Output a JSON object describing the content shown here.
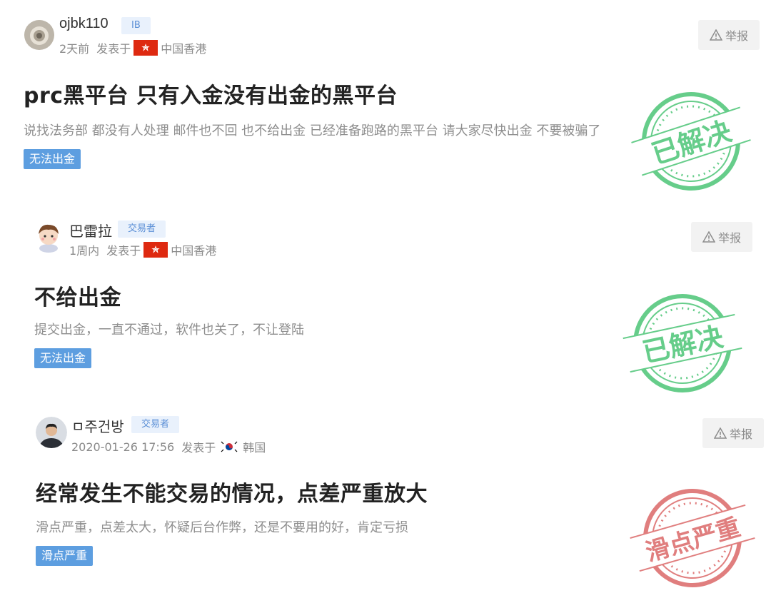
{
  "report_label": "举报",
  "posts": [
    {
      "user": "ojbk110",
      "role": "IB",
      "time": "2天前",
      "posted_in": "发表于",
      "region": "中国香港",
      "title": "prc黑平台 只有入金没有出金的黑平台",
      "body": "说找法务部 都没有人处理 邮件也不回 也不给出金 已经准备跑路的黑平台 请大家尽快出金 不要被骗了",
      "tag": "无法出金",
      "stamp": "已解决",
      "stamp_color": "#3cbf6a"
    },
    {
      "user": "巴雷拉",
      "role": "交易者",
      "time": "1周内",
      "posted_in": "发表于",
      "region": "中国香港",
      "title": "不给出金",
      "body": "提交出金，一直不通过，软件也关了，不让登陆",
      "tag": "无法出金",
      "stamp": "已解决",
      "stamp_color": "#3cbf6a"
    },
    {
      "user": "ㅁ주건방",
      "role": "交易者",
      "time": "2020-01-26 17:56",
      "posted_in": "发表于",
      "region": "韩国",
      "title": "经常发生不能交易的情况，点差严重放大",
      "body": "滑点严重，点差太大，怀疑后台作弊，还是不要用的好，肯定亏损",
      "tag": "滑点严重",
      "stamp": "滑点严重",
      "stamp_color": "#d85a5a"
    }
  ]
}
